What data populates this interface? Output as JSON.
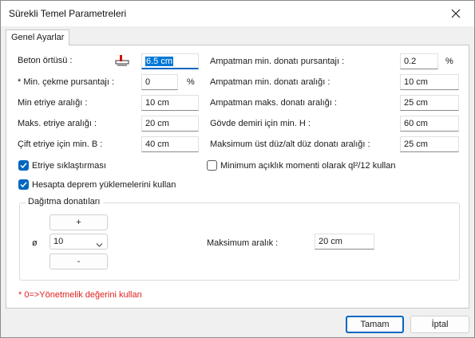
{
  "window": {
    "title": "Sürekli Temel Parametreleri"
  },
  "tab": {
    "label": "Genel Ayarlar"
  },
  "left": {
    "beton_ortusu": {
      "label": "Beton örtüsü :",
      "value": "6.5 cm"
    },
    "min_cekme": {
      "label": "* Min. çekme pursantajı :",
      "value": "0",
      "unit": "%"
    },
    "min_etriye": {
      "label": "Min etriye aralığı :",
      "value": "10 cm"
    },
    "maks_etriye": {
      "label": "Maks. etriye aralığı :",
      "value": "20 cm"
    },
    "cift_etriye": {
      "label": "Çift etriye için min. B :",
      "value": "40 cm"
    }
  },
  "right": {
    "ampatman_min_pursantaj": {
      "label": "Ampatman min. donatı pursantajı :",
      "value": "0.2",
      "unit": "%"
    },
    "ampatman_min_aralik": {
      "label": "Ampatman min. donatı aralığı :",
      "value": "10 cm"
    },
    "ampatman_maks_aralik": {
      "label": "Ampatman maks. donatı aralığı :",
      "value": "25 cm"
    },
    "govde_demiri": {
      "label": "Gövde demiri için min. H :",
      "value": "60 cm"
    },
    "maks_ust_alt": {
      "label": "Maksimum üst düz/alt düz donatı aralığı :",
      "value": "25 cm"
    }
  },
  "checks": {
    "etriye_siklastirmasi": {
      "label": "Etriye sıklaştırması",
      "checked": true
    },
    "minimum_aciklik": {
      "label": "Minimum açıklık momenti olarak ql²/12 kullan",
      "checked": false
    },
    "deprem_yuk": {
      "label": "Hesapta deprem yüklemelerini kullan",
      "checked": true
    }
  },
  "dagitma": {
    "title": "Dağıtma donatıları",
    "plus_label": "+",
    "minus_label": "-",
    "phi_label": "ø",
    "diameter_value": "10",
    "maks_aralik_label": "Maksimum aralık :",
    "maks_aralik_value": "20 cm"
  },
  "note": "* 0=>Yönetmelik değerini kullan",
  "buttons": {
    "ok": "Tamam",
    "cancel": "İptal"
  },
  "colors": {
    "accent": "#0067c0",
    "note": "#e02020"
  }
}
